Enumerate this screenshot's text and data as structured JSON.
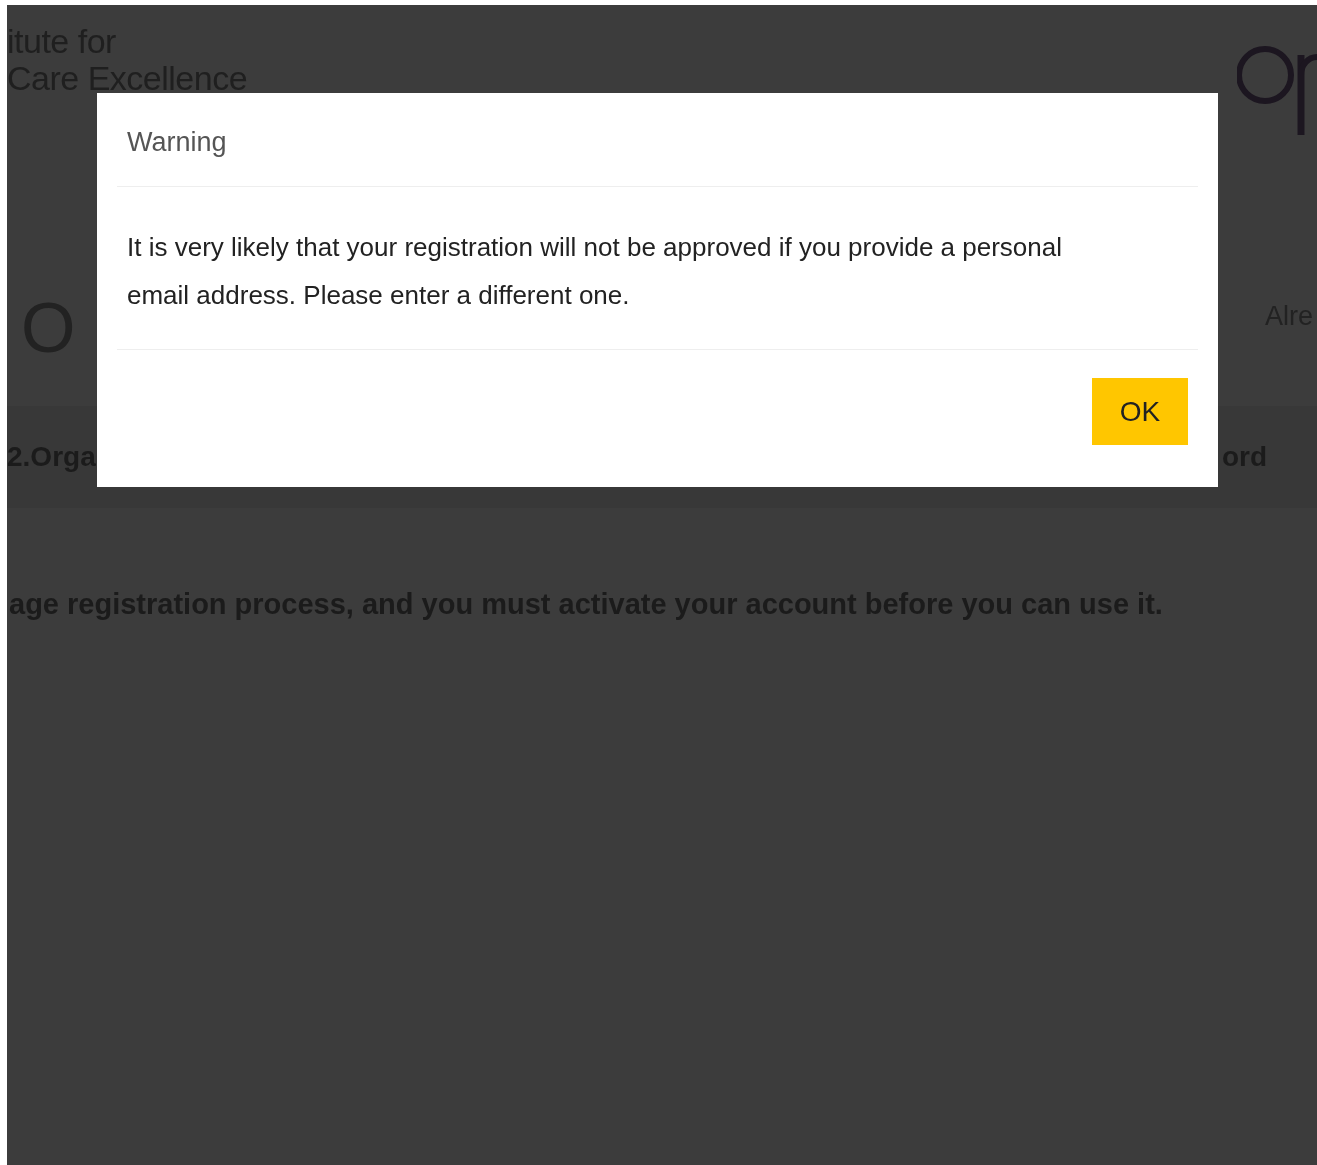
{
  "background_page": {
    "logo_text": [
      "itute for",
      "Care Excellence"
    ],
    "heading": "O",
    "login_prompt": "Alre",
    "steps": [
      "2.Orga",
      "ord"
    ],
    "intro": "age registration process, and you must activate your account before you can use it."
  },
  "dialog": {
    "title": "Warning",
    "message": "It is very likely that your registration will not be approved if you provide a personal email address. Please enter a different one.",
    "buttons": [
      "OK"
    ]
  }
}
